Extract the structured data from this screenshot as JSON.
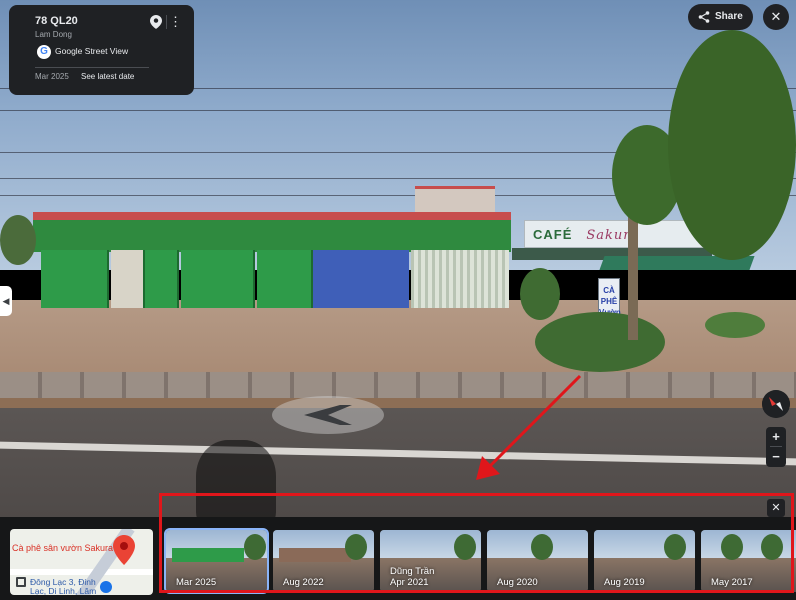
{
  "location_card": {
    "title": "78 QL20",
    "subtitle": "Lam Dong",
    "provider": "Google Street View",
    "capture_date": "Mar 2025",
    "latest_link": "See latest date"
  },
  "scene": {
    "cafe_sign": "CAFÉ",
    "cafe_sign_script": "Sakura",
    "cafe_board": "CÀ PHÊ Vườn"
  },
  "top_controls": {
    "share_label": "Share",
    "close_label": "✕"
  },
  "side_tab_label": "◀",
  "zoom": {
    "in": "+",
    "out": "−"
  },
  "minimap": {
    "place_name": "Cà phê sân vườn Sakura",
    "address_line1": "Đông Lạc 3, Đinh",
    "address_line2": "Lạc, Di Linh, Lâm"
  },
  "timeline": {
    "close_label": "✕",
    "entries": [
      {
        "label": "Mar 2025",
        "selected": true
      },
      {
        "label": "Aug 2022",
        "selected": false
      },
      {
        "label": "Dũng Trần",
        "label2": "Apr 2021",
        "selected": false
      },
      {
        "label": "Aug 2020",
        "selected": false
      },
      {
        "label": "Aug 2019",
        "selected": false
      },
      {
        "label": "May 2017",
        "selected": false
      }
    ]
  },
  "colors": {
    "panel": "#1f2124",
    "accent_selected": "#8ab4f8",
    "annotation_red": "#e0161b",
    "warehouse_green": "#2e9b49",
    "warehouse_blue": "#3f5fb8"
  },
  "icons": {
    "pin": "pin-icon",
    "more": "more-vert-icon",
    "share": "share-icon",
    "close": "close-icon",
    "compass": "compass-icon",
    "expand": "expand-icon",
    "google": "google-logo-icon"
  }
}
